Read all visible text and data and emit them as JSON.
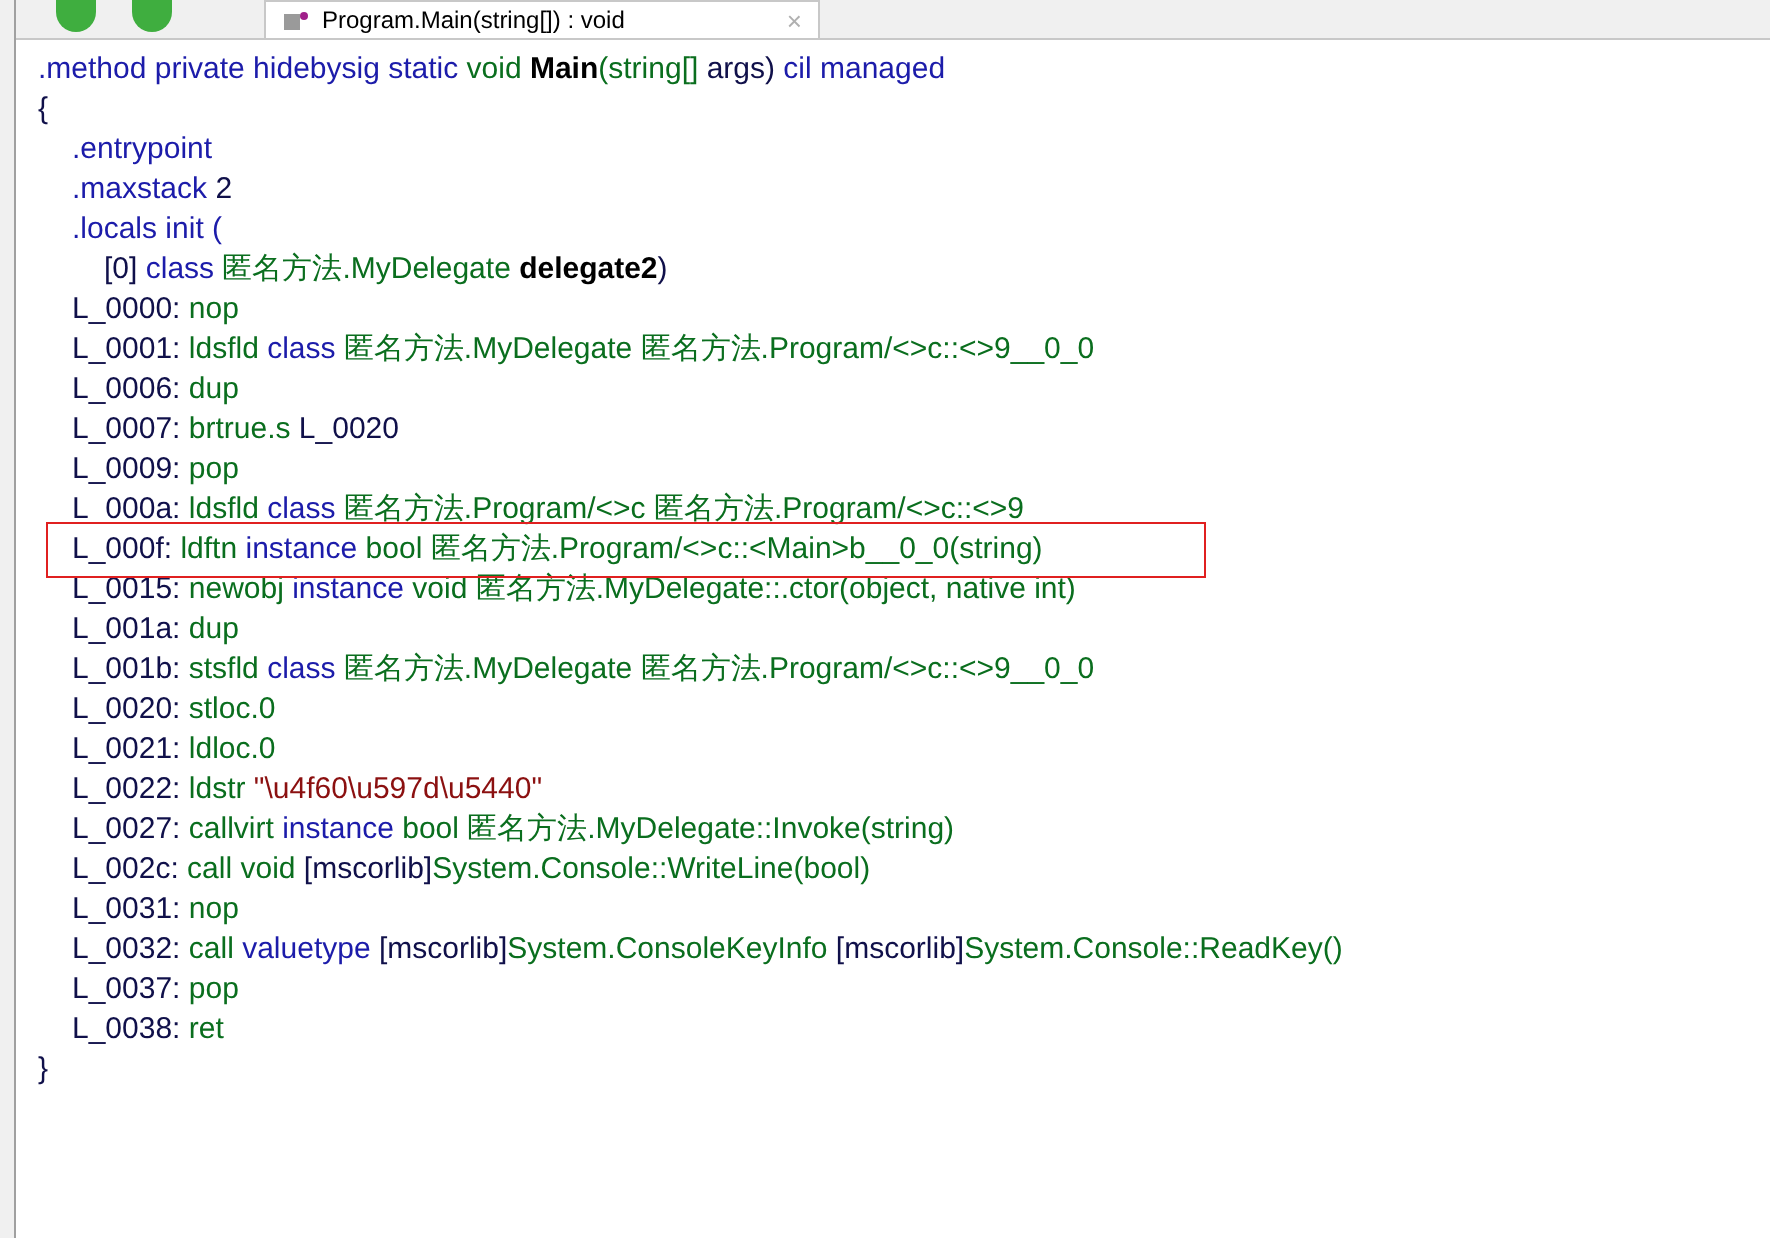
{
  "tab": {
    "title": "Program.Main(string[]) : void",
    "close": "×"
  },
  "lines": [
    {
      "kind": "top",
      "tokens": [
        {
          "text": ".method private hidebysig static ",
          "kind": "kw"
        },
        {
          "text": "void ",
          "kind": "type"
        },
        {
          "text": "Main",
          "kind": "bold"
        },
        {
          "text": "(string[] ",
          "kind": "type"
        },
        {
          "text": "args) ",
          "kind": "label"
        },
        {
          "text": "cil managed",
          "kind": "kw"
        }
      ]
    },
    {
      "kind": "top",
      "tokens": [
        {
          "text": "{",
          "kind": "label"
        }
      ]
    },
    {
      "kind": "body",
      "tokens": [
        {
          "text": ".entrypoint",
          "kind": "kw"
        }
      ]
    },
    {
      "kind": "body",
      "tokens": [
        {
          "text": ".maxstack ",
          "kind": "kw"
        },
        {
          "text": "2",
          "kind": "label"
        }
      ]
    },
    {
      "kind": "body",
      "tokens": [
        {
          "text": ".locals init (",
          "kind": "kw"
        }
      ]
    },
    {
      "kind": "nested",
      "tokens": [
        {
          "text": "[0] ",
          "kind": "label"
        },
        {
          "text": "class ",
          "kind": "kw"
        },
        {
          "text": "匿名方法.MyDelegate ",
          "kind": "type"
        },
        {
          "text": "delegate2",
          "kind": "bold"
        },
        {
          "text": ")",
          "kind": "label"
        }
      ]
    },
    {
      "kind": "body",
      "tokens": [
        {
          "text": "L_0000: ",
          "kind": "label"
        },
        {
          "text": "nop",
          "kind": "op"
        }
      ]
    },
    {
      "kind": "body",
      "tokens": [
        {
          "text": "L_0001: ",
          "kind": "label"
        },
        {
          "text": "ldsfld ",
          "kind": "op"
        },
        {
          "text": "class ",
          "kind": "kw"
        },
        {
          "text": "匿名方法.MyDelegate 匿名方法.Program/<>c::<>9__0_0",
          "kind": "type"
        }
      ]
    },
    {
      "kind": "body",
      "tokens": [
        {
          "text": "L_0006: ",
          "kind": "label"
        },
        {
          "text": "dup",
          "kind": "op"
        }
      ]
    },
    {
      "kind": "body",
      "tokens": [
        {
          "text": "L_0007: ",
          "kind": "label"
        },
        {
          "text": "brtrue.s ",
          "kind": "op"
        },
        {
          "text": "L_0020",
          "kind": "label"
        }
      ]
    },
    {
      "kind": "body",
      "tokens": [
        {
          "text": "L_0009: ",
          "kind": "label"
        },
        {
          "text": "pop",
          "kind": "op"
        }
      ]
    },
    {
      "kind": "body",
      "tokens": [
        {
          "text": "L_000a: ",
          "kind": "label"
        },
        {
          "text": "ldsfld ",
          "kind": "op"
        },
        {
          "text": "class ",
          "kind": "kw"
        },
        {
          "text": "匿名方法.Program/<>c 匿名方法.Program/<>c::<>9",
          "kind": "type"
        }
      ]
    },
    {
      "kind": "body",
      "highlighted": true,
      "tokens": [
        {
          "text": "L_000f: ",
          "kind": "label"
        },
        {
          "text": "ldftn ",
          "kind": "op"
        },
        {
          "text": "instance ",
          "kind": "kw"
        },
        {
          "text": "bool 匿名方法.Program/<>c::<Main>b__0_0(string)",
          "kind": "type"
        }
      ]
    },
    {
      "kind": "body",
      "tokens": [
        {
          "text": "L_0015: ",
          "kind": "label"
        },
        {
          "text": "newobj ",
          "kind": "op"
        },
        {
          "text": "instance ",
          "kind": "kw"
        },
        {
          "text": "void 匿名方法.MyDelegate::.ctor(object, native int)",
          "kind": "type"
        }
      ]
    },
    {
      "kind": "body",
      "tokens": [
        {
          "text": "L_001a: ",
          "kind": "label"
        },
        {
          "text": "dup",
          "kind": "op"
        }
      ]
    },
    {
      "kind": "body",
      "tokens": [
        {
          "text": "L_001b: ",
          "kind": "label"
        },
        {
          "text": "stsfld ",
          "kind": "op"
        },
        {
          "text": "class ",
          "kind": "kw"
        },
        {
          "text": "匿名方法.MyDelegate 匿名方法.Program/<>c::<>9__0_0",
          "kind": "type"
        }
      ]
    },
    {
      "kind": "body",
      "tokens": [
        {
          "text": "L_0020: ",
          "kind": "label"
        },
        {
          "text": "stloc.0",
          "kind": "op"
        }
      ]
    },
    {
      "kind": "body",
      "tokens": [
        {
          "text": "L_0021: ",
          "kind": "label"
        },
        {
          "text": "ldloc.0",
          "kind": "op"
        }
      ]
    },
    {
      "kind": "body",
      "tokens": [
        {
          "text": "L_0022: ",
          "kind": "label"
        },
        {
          "text": "ldstr ",
          "kind": "op"
        },
        {
          "text": "\"\\u4f60\\u597d\\u5440\"",
          "kind": "str"
        }
      ]
    },
    {
      "kind": "body",
      "tokens": [
        {
          "text": "L_0027: ",
          "kind": "label"
        },
        {
          "text": "callvirt ",
          "kind": "op"
        },
        {
          "text": "instance ",
          "kind": "kw"
        },
        {
          "text": "bool 匿名方法.MyDelegate::Invoke(string)",
          "kind": "type"
        }
      ]
    },
    {
      "kind": "body",
      "tokens": [
        {
          "text": "L_002c: ",
          "kind": "label"
        },
        {
          "text": "call ",
          "kind": "op"
        },
        {
          "text": "void ",
          "kind": "type"
        },
        {
          "text": "[mscorlib]",
          "kind": "label"
        },
        {
          "text": "System.Console::WriteLine(bool)",
          "kind": "type"
        }
      ]
    },
    {
      "kind": "body",
      "tokens": [
        {
          "text": "L_0031: ",
          "kind": "label"
        },
        {
          "text": "nop",
          "kind": "op"
        }
      ]
    },
    {
      "kind": "body",
      "tokens": [
        {
          "text": "L_0032: ",
          "kind": "label"
        },
        {
          "text": "call ",
          "kind": "op"
        },
        {
          "text": "valuetype ",
          "kind": "kw"
        },
        {
          "text": "[mscorlib]",
          "kind": "label"
        },
        {
          "text": "System.ConsoleKeyInfo ",
          "kind": "type"
        },
        {
          "text": "[mscorlib]",
          "kind": "label"
        },
        {
          "text": "System.Console::ReadKey()",
          "kind": "type"
        }
      ]
    },
    {
      "kind": "body",
      "tokens": [
        {
          "text": "L_0037: ",
          "kind": "label"
        },
        {
          "text": "pop",
          "kind": "op"
        }
      ]
    },
    {
      "kind": "body",
      "tokens": [
        {
          "text": "L_0038: ",
          "kind": "label"
        },
        {
          "text": "ret",
          "kind": "op"
        }
      ]
    },
    {
      "kind": "top",
      "tokens": [
        {
          "text": "}",
          "kind": "label"
        }
      ]
    }
  ]
}
